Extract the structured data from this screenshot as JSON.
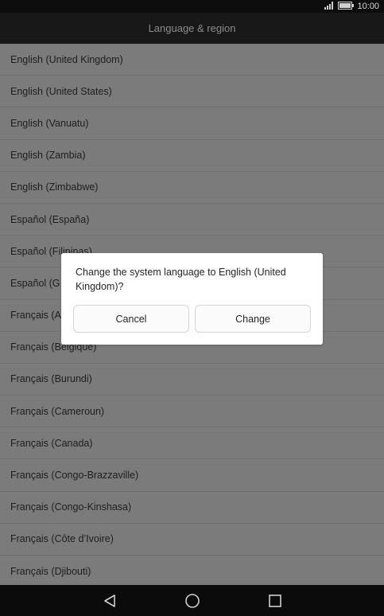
{
  "status_bar": {
    "time": "10:00",
    "icons": [
      "signal-icon",
      "battery-icon"
    ]
  },
  "header": {
    "title": "Language & region"
  },
  "languages": [
    "English (United Kingdom)",
    "English (United States)",
    "English (Vanuatu)",
    "English (Zambia)",
    "English (Zimbabwe)",
    "Español (España)",
    "Español (Filipinas)",
    "Español (G",
    "Français (A",
    "Français (Belgique)",
    "Français (Burundi)",
    "Français (Cameroun)",
    "Français (Canada)",
    "Français (Congo-Brazzaville)",
    "Français (Congo-Kinshasa)",
    "Français (Côte d’Ivoire)",
    "Français (Djibouti)"
  ],
  "dialog": {
    "message": "Change the system language to English (United Kingdom)?",
    "cancel_label": "Cancel",
    "change_label": "Change"
  },
  "nav_bar": {
    "icons": [
      "back-icon",
      "home-icon",
      "recents-icon"
    ]
  },
  "colors": {
    "overlay_list_bg": "#7b7b7b",
    "dialog_bg": "#ffffff",
    "system_bar_bg": "#0b0b0b"
  }
}
